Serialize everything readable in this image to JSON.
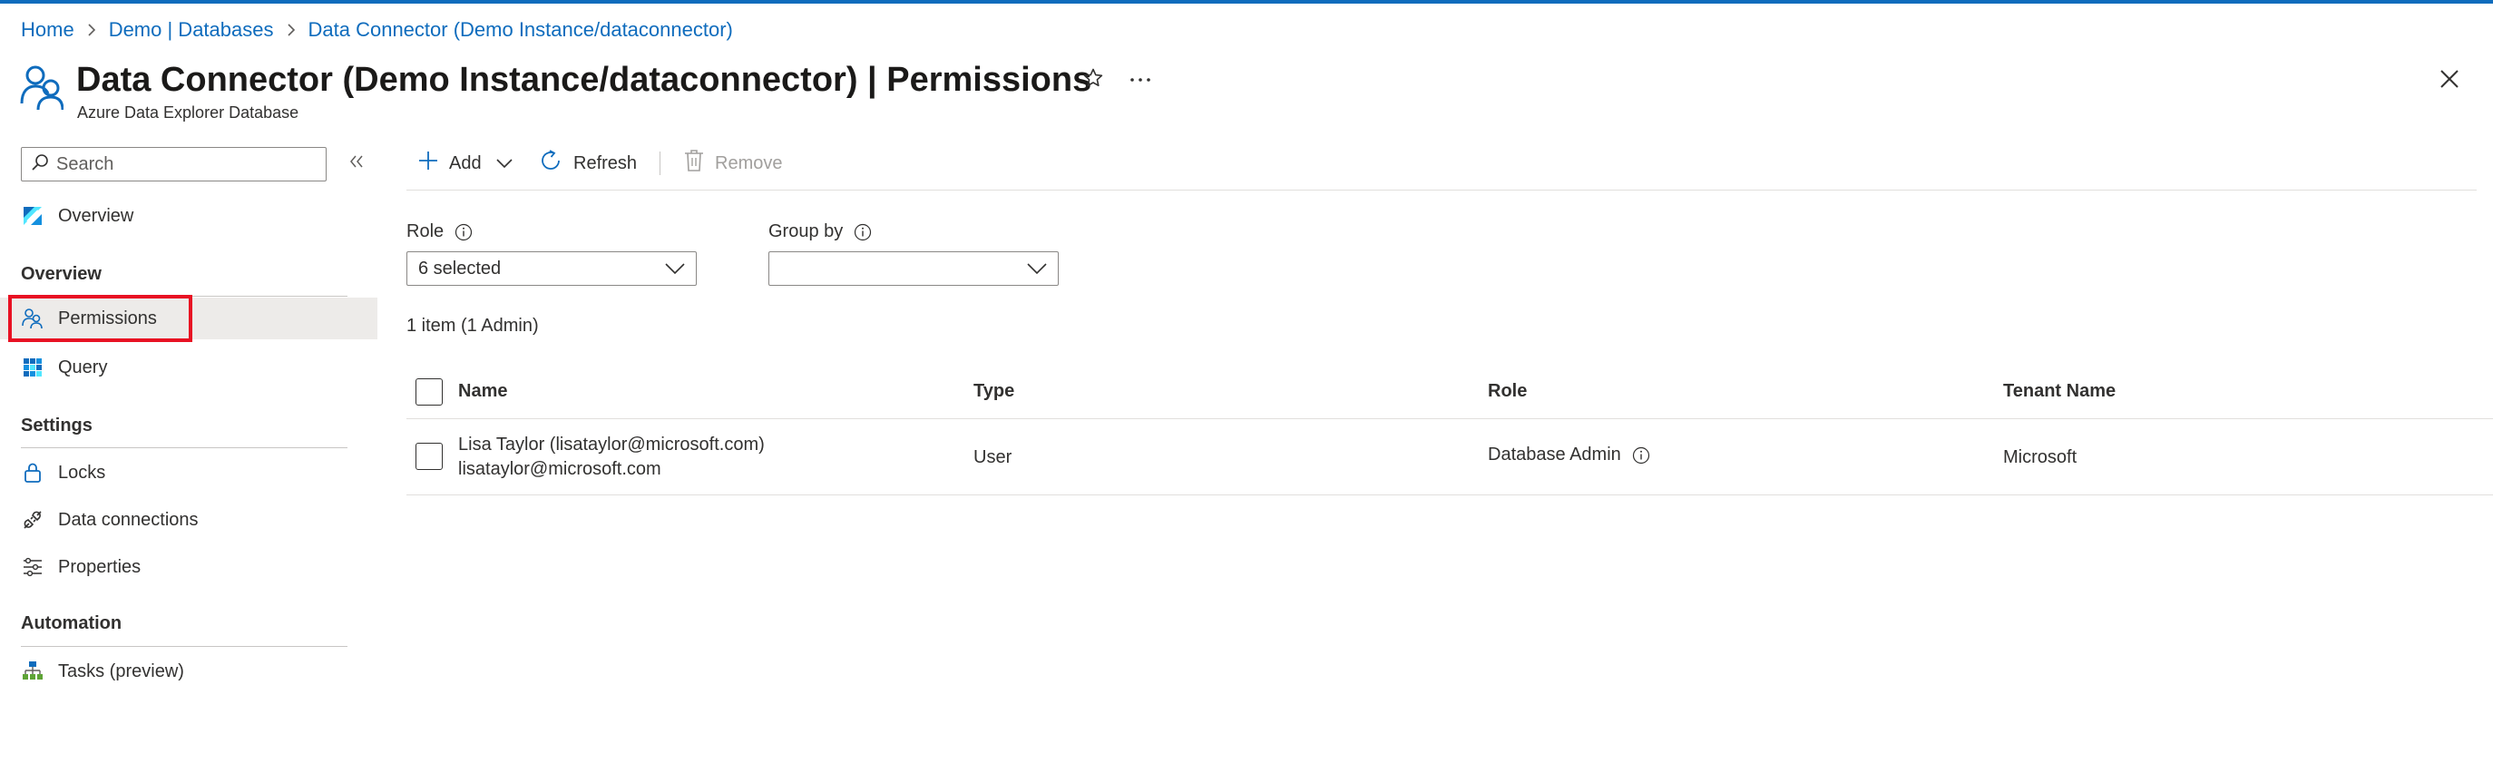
{
  "breadcrumb": {
    "items": [
      "Home",
      "Demo | Databases",
      "Data Connector (Demo Instance/dataconnector)"
    ]
  },
  "header": {
    "title": "Data Connector (Demo Instance/dataconnector) | Permissions",
    "subtitle": "Azure Data Explorer Database",
    "icon": "users-icon"
  },
  "sidebar": {
    "search_placeholder": "Search",
    "overview_item": "Overview",
    "sections": [
      {
        "title": "Overview",
        "items": [
          "Permissions",
          "Query"
        ]
      },
      {
        "title": "Settings",
        "items": [
          "Locks",
          "Data connections",
          "Properties"
        ]
      },
      {
        "title": "Automation",
        "items": [
          "Tasks (preview)"
        ]
      }
    ],
    "selected_item": "Permissions"
  },
  "toolbar": {
    "add_label": "Add",
    "refresh_label": "Refresh",
    "remove_label": "Remove"
  },
  "filters": {
    "role_label": "Role",
    "role_value": "6 selected",
    "group_by_label": "Group by",
    "group_by_value": ""
  },
  "summary": "1 item (1 Admin)",
  "table": {
    "columns": [
      "Name",
      "Type",
      "Role",
      "Tenant Name"
    ],
    "rows": [
      {
        "name": "Lisa Taylor (lisataylor@microsoft.com)",
        "email": "lisataylor@microsoft.com",
        "type": "User",
        "role": "Database Admin",
        "tenant": "Microsoft"
      }
    ]
  },
  "colors": {
    "accent": "#0f6cbd",
    "highlight": "#e81123",
    "selected_bg": "#edebe9"
  }
}
